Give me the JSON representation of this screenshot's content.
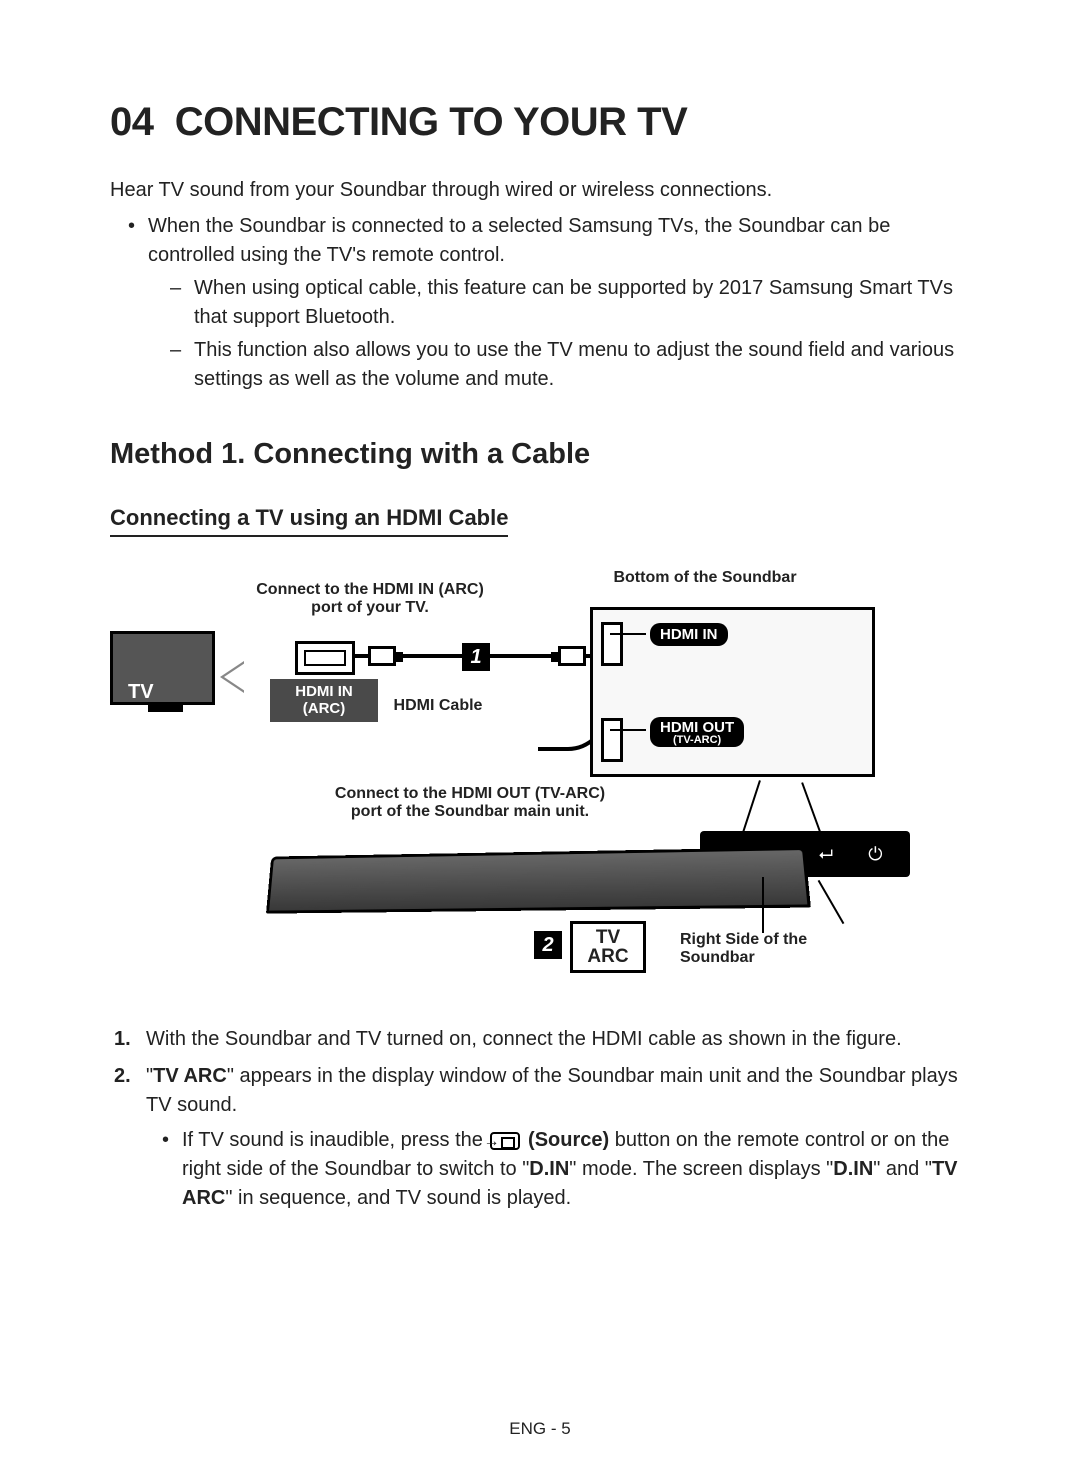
{
  "header": {
    "section_number": "04",
    "section_title": "CONNECTING TO YOUR TV"
  },
  "intro": "Hear TV sound from your Soundbar through wired or wireless connections.",
  "bullet1": "When the Soundbar is connected to a selected Samsung TVs, the Soundbar can be controlled using the TV's remote control.",
  "dash1": "When using optical cable, this feature can be supported by 2017 Samsung Smart TVs that support Bluetooth.",
  "dash2": "This function also allows you to use the TV menu to adjust the sound field and various settings as well as the volume and mute.",
  "method_heading": "Method 1. Connecting with a Cable",
  "sub_heading": "Connecting a TV using an HDMI Cable",
  "diagram": {
    "label_top": "Connect to the HDMI IN (ARC) port of your TV.",
    "label_bottom_sb": "Bottom of the Soundbar",
    "tv_label": "TV",
    "hdmi_in_arc": "HDMI IN\n(ARC)",
    "hdmi_cable": "HDMI Cable",
    "hdmi_in_port": "HDMI IN",
    "hdmi_out_port": "HDMI OUT",
    "hdmi_out_port_sub": "(TV-ARC)",
    "label_out": "Connect to the HDMI OUT (TV-ARC) port of the Soundbar main unit.",
    "tv_arc_box_line1": "TV",
    "tv_arc_box_line2": "ARC",
    "right_side": "Right Side of the Soundbar",
    "step1": "1",
    "step2": "2",
    "panel_minus": "−",
    "panel_plus": "+",
    "panel_source": "⮠",
    "panel_power": "⏻"
  },
  "steps": {
    "s1": "With the Soundbar and TV turned on, connect the HDMI cable as shown in the figure.",
    "s2_prefix": "\"",
    "s2_tvarc": "TV ARC",
    "s2_rest": "\" appears in the display window of the Soundbar main unit and the Soundbar plays TV sound.",
    "s2_sub_pre": "If TV sound is inaudible, press the ",
    "s2_source": "(Source)",
    "s2_sub_mid1": " button on the remote control or on the right side of the Soundbar to switch to \"",
    "s2_din": "D.IN",
    "s2_sub_mid2": "\" mode. The screen displays \"",
    "s2_sub_mid3": "\" and \"",
    "s2_sub_end": "\" in sequence, and TV sound is played."
  },
  "footer": "ENG - 5"
}
